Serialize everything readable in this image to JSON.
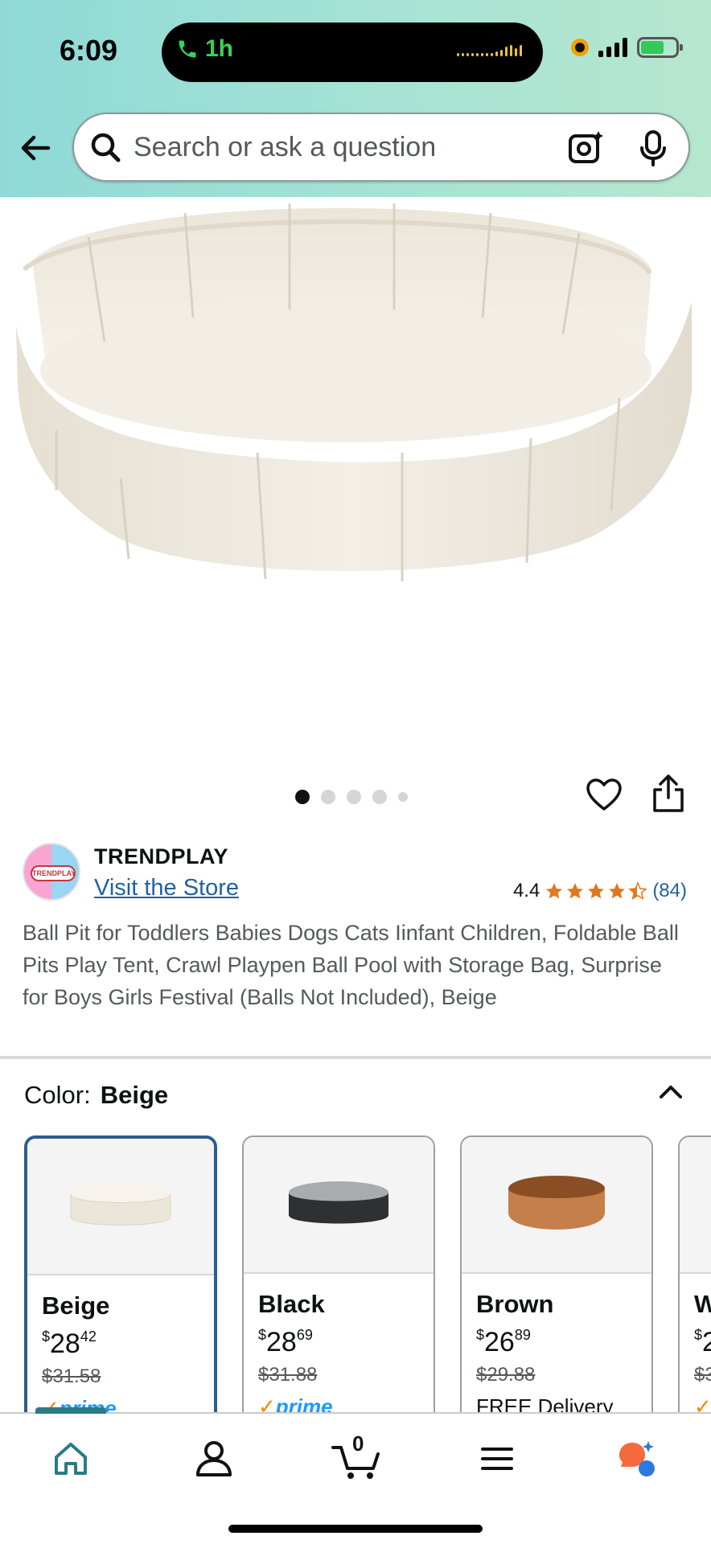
{
  "status_bar": {
    "time": "6:09",
    "call_duration": "1h",
    "accent_call": "#35d25a"
  },
  "header": {
    "search_placeholder": "Search or ask a question",
    "icons": [
      "back-arrow-icon",
      "search-icon",
      "camera-lens-icon",
      "microphone-icon"
    ]
  },
  "gallery": {
    "image_count": 5,
    "active_index": 0
  },
  "brand": {
    "name": "TRENDPLAY",
    "visit_store": "Visit the Store",
    "logo_text": "TRENDPLAY"
  },
  "rating": {
    "value": "4.4",
    "stars": 4.4,
    "count": "(84)",
    "star_color": "#de7921"
  },
  "product": {
    "title": "Ball Pit for Toddlers Babies Dogs Cats Iinfant Children, Foldable Ball Pits Play Tent, Crawl Playpen Ball Pool with Storage Bag, Surprise for Boys Girls Festival (Balls Not Included), Beige"
  },
  "color_selector": {
    "label": "Color:",
    "selected": "Beige",
    "options": [
      {
        "name": "Beige",
        "symbol": "$",
        "whole": "28",
        "fraction": "42",
        "was": "$31.58",
        "badge": "prime",
        "selected": true,
        "tint": "#efeae0"
      },
      {
        "name": "Black",
        "symbol": "$",
        "whole": "28",
        "fraction": "69",
        "was": "$31.88",
        "badge": "prime",
        "selected": false,
        "tint": "#2f3032"
      },
      {
        "name": "Brown",
        "symbol": "$",
        "whole": "26",
        "fraction": "89",
        "was": "$29.88",
        "badge": "FREE Delivery",
        "selected": false,
        "tint": "#c57f4a"
      },
      {
        "name": "W",
        "symbol": "$",
        "whole": "2",
        "fraction": "",
        "was": "$3",
        "badge": "prime",
        "selected": false,
        "tint": "#f4f4f4"
      }
    ],
    "prime_check": "✓",
    "prime_text": "prime"
  },
  "bottom_nav": {
    "items": [
      "home-icon",
      "account-icon",
      "cart-icon",
      "menu-icon",
      "rufus-icon"
    ],
    "cart_count": "0",
    "active": "home-icon"
  }
}
